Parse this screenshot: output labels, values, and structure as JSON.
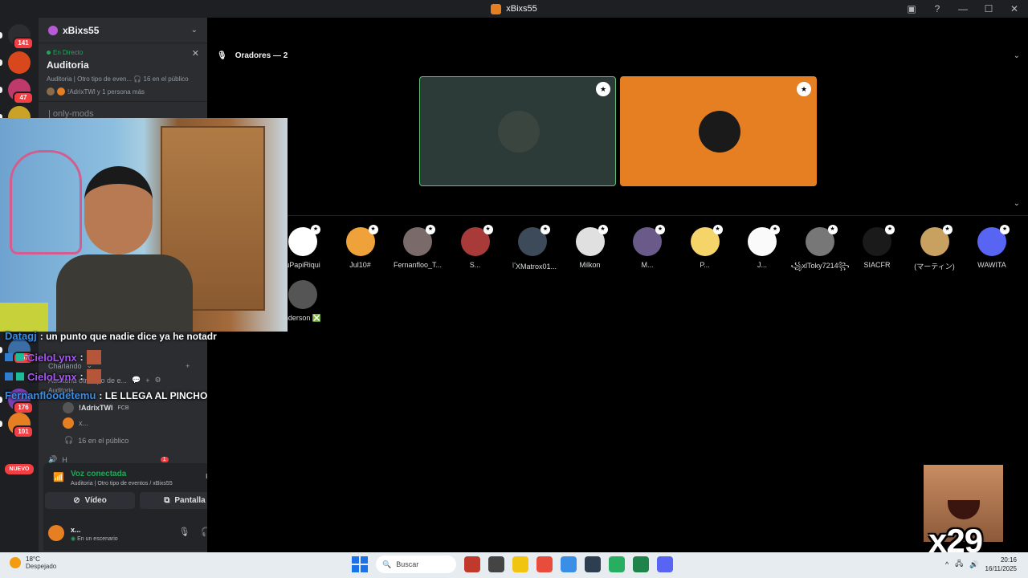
{
  "window": {
    "title": "xBixs55",
    "controls": [
      "▣",
      "?",
      "—",
      "☐",
      "✕"
    ]
  },
  "rail": {
    "servers": [
      {
        "badge": "141",
        "color": "#2b2d31"
      },
      {
        "badge": "",
        "color": "#d9481c"
      },
      {
        "badge": "47",
        "color": "#c0396b"
      },
      {
        "badge": "",
        "color": "#c9a227"
      },
      {
        "badge": "367",
        "color": "#3a6ea5"
      },
      {
        "badge": "176",
        "color": "#7a3fb0"
      },
      {
        "badge": "101",
        "color": "#e67e22"
      }
    ],
    "new_label": "NUEVO"
  },
  "sidebar": {
    "server_name": "xBixs55",
    "event": {
      "live_label": "En Directo",
      "title": "Auditoria",
      "meta": "Auditoria | Otro tipo de even...  🎧 16 en el público",
      "people": "!AdrixTWl y 1 persona más"
    },
    "channel_only": "| only-mods",
    "vc_section": "Charlando",
    "vc_channel": "Auditoria",
    "vc_channel_sub": "Auditoria",
    "vc_event_row": "Auditoria  otro tipo de e...",
    "vc_user": "!AdrixTWl",
    "vc_user_tag": "FCB",
    "vc_user2": "x...",
    "vc_audience": "16 en el público",
    "vc_next": "H",
    "vc_next_badge": "1"
  },
  "voice_panel": {
    "title": "Voz conectada",
    "subtitle": "Auditoria | Otro tipo de eventos / xBixs55",
    "video_label": "Vídeo",
    "screen_label": "Pantalla"
  },
  "user_panel": {
    "name": "x...",
    "status": "En un escenario"
  },
  "stage": {
    "speakers_heading": "Oradores — 2",
    "speakers": [
      {
        "color": "#2d3b38",
        "border": "#5fbf7a",
        "avatar": "#3a4540"
      },
      {
        "color": "#e67e22",
        "border": "#e67e22",
        "avatar": "#1a1a1a"
      }
    ],
    "audience_row1": [
      {
        "name": "uPapiRiqui",
        "color": "#ffffff"
      },
      {
        "name": "Jul10#",
        "color": "#f0a23a"
      },
      {
        "name": "Fernanfloo_T...",
        "color": "#7a6a6a"
      },
      {
        "name": "S...",
        "color": "#a83a3a"
      },
      {
        "name": "『XMatrox01...",
        "color": "#3d4a5a"
      },
      {
        "name": "Milkon",
        "color": "#e0e0e0"
      },
      {
        "name": "M...",
        "color": "#6a5a8a"
      },
      {
        "name": "P...",
        "color": "#f5d46a"
      },
      {
        "name": "J...",
        "color": "#fafafa"
      },
      {
        "name": "꧁xlToky7214꧂...",
        "color": "#777777"
      },
      {
        "name": "SIACFR",
        "color": "#1a1a1a"
      },
      {
        "name": "(マーティン)",
        "color": "#c8a060"
      },
      {
        "name": "WAWITA",
        "color": "#5865f2"
      }
    ],
    "audience_row2": [
      {
        "name": "nderson ❎",
        "color": "#555555"
      }
    ]
  },
  "chat": [
    {
      "nick": "Datagj",
      "nick_color": "#3a8ee6",
      "text": ": un punto que nadie dice ya he notadr",
      "emote": false
    },
    {
      "nick": "CieloLynx",
      "nick_color": "#a855f7",
      "text": ":",
      "emote": true
    },
    {
      "nick": "CieloLynx",
      "nick_color": "#a855f7",
      "text": ":",
      "emote": true
    },
    {
      "nick": "Fernanfloodetemu",
      "nick_color": "#3a8ee6",
      "text": ": LE LLEGA AL PINCHO",
      "emote": false
    }
  ],
  "meme": {
    "count": "x29"
  },
  "taskbar": {
    "temp": "18°C",
    "weather": "Despejado",
    "search": "Buscar",
    "time": "20:16",
    "date": "16/11/2025",
    "apps": [
      "#c0392b",
      "#444444",
      "#f1c40f",
      "#e74c3c",
      "#3a8ee6",
      "#2c3e50",
      "#27ae60",
      "#1e8449",
      "#5865f2"
    ]
  }
}
